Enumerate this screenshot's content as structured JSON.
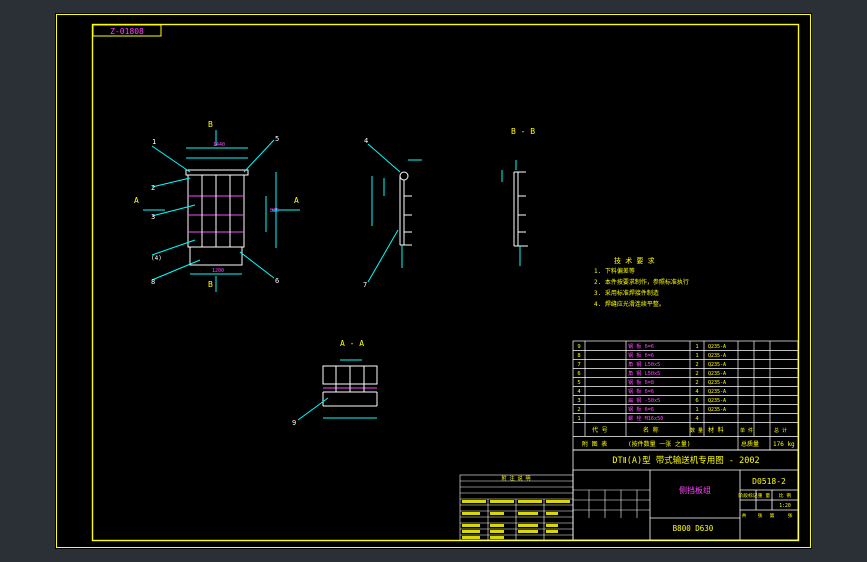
{
  "colors": {
    "viewport_bg": "#2b2f36",
    "sheet_bg": "#000000",
    "frame": "#ffff00",
    "line_white": "#ffffff",
    "line_cyan": "#00ffff",
    "text_yellow": "#ffff00",
    "text_magenta": "#ff44ff",
    "accent_green": "#00ff00",
    "accent_blue": "#6060ff",
    "accent_red": "#ff3030"
  },
  "header": {
    "code_box": "Z-01808"
  },
  "views": {
    "main": {
      "section_B_top": "B",
      "section_B_bottom": "B",
      "section_A_left": "A",
      "section_A_right": "A",
      "balloons": [
        "1",
        "2",
        "3",
        "(4)",
        "5",
        "6",
        "8"
      ]
    },
    "side": {
      "balloons": [
        "4",
        "7"
      ]
    },
    "section_bb": {
      "title": "B - B"
    },
    "section_aa": {
      "title": "A - A",
      "balloons": [
        "9"
      ]
    }
  },
  "tech_requirements": {
    "title": "技 术 要 求",
    "items": [
      "1. 下料偏差等",
      "2. 本件按要求制作，参照标准执行",
      "3. 采用标准焊接件制造",
      "4. 焊缝应光滑连续平整。"
    ]
  },
  "parts_table": {
    "rows": [
      {
        "no": "9",
        "code": "",
        "name": "钢 板  δ=6",
        "qty": "1",
        "mat": "Q235-A",
        "w1": "",
        "w2": ""
      },
      {
        "no": "8",
        "code": "",
        "name": "钢 板  δ=6",
        "qty": "1",
        "mat": "Q235-A",
        "w1": "",
        "w2": ""
      },
      {
        "no": "7",
        "code": "",
        "name": "角 钢  L50x5",
        "qty": "2",
        "mat": "Q235-A",
        "w1": "",
        "w2": ""
      },
      {
        "no": "6",
        "code": "",
        "name": "角 钢  L50x5",
        "qty": "2",
        "mat": "Q235-A",
        "w1": "",
        "w2": ""
      },
      {
        "no": "5",
        "code": "",
        "name": "钢 板  δ=8",
        "qty": "2",
        "mat": "Q235-A",
        "w1": "",
        "w2": ""
      },
      {
        "no": "4",
        "code": "",
        "name": "钢 板  δ=6",
        "qty": "4",
        "mat": "Q235-A",
        "w1": "",
        "w2": ""
      },
      {
        "no": "3",
        "code": "",
        "name": "扁 钢  -50x5",
        "qty": "6",
        "mat": "Q235-A",
        "w1": "",
        "w2": ""
      },
      {
        "no": "2",
        "code": "",
        "name": "钢 板  δ=6",
        "qty": "1",
        "mat": "Q235-A",
        "w1": "",
        "w2": ""
      },
      {
        "no": "1",
        "code": "",
        "name": "螺 栓  M16x50",
        "qty": "4",
        "mat": "",
        "w1": "",
        "w2": ""
      }
    ],
    "header": [
      "代 号",
      "名 称",
      "数 量",
      "材 料",
      "单 件",
      "总 计"
    ],
    "summary_left": "附 图 表",
    "summary_mid": "(按件数量 一张 之量)",
    "summary_label": "总质量",
    "summary_value": "176 kg"
  },
  "title_block": {
    "main_title": "DTⅡ(A)型  带式输送机专用图 - 2002",
    "drawing_name": "侧挡板组",
    "drawing_no": "D0518-2",
    "bottom_codes": "B800  D630",
    "small_labels": [
      "阶段标记",
      "重 量",
      "比 例",
      "1:20",
      "共",
      "张",
      "第",
      "张"
    ]
  },
  "notes_table": {
    "title": "附 注 说 明"
  }
}
